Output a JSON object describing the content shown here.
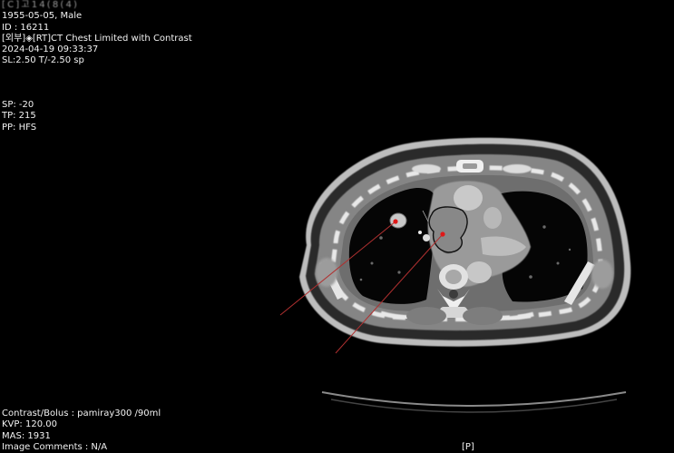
{
  "header": {
    "patient_name": "[ C ] 고 1 4 ( 8 ( 4 )",
    "birth_sex": "1955-05-05, Male",
    "patient_id": "ID : 16211",
    "study_description": "[외부]◈[RT]CT Chest Limited with Contrast",
    "study_datetime": "2024-04-19 09:33:37",
    "slice_info": "SL:2.50 T/-2.50 sp"
  },
  "position": {
    "sp": "SP: -20",
    "tp": "TP: 215",
    "pp": "PP: HFS"
  },
  "footer": {
    "contrast": "Contrast/Bolus : pamiray300 /90ml",
    "kvp": "KVP: 120.00",
    "mas": "MAS: 1931",
    "comments": "Image Comments : N/A"
  },
  "orientation": {
    "bottom": "[P]"
  },
  "colors": {
    "background": "#000000",
    "text": "#f2f2f2",
    "annotation_line": "#b03030",
    "marker": "#e01818"
  }
}
